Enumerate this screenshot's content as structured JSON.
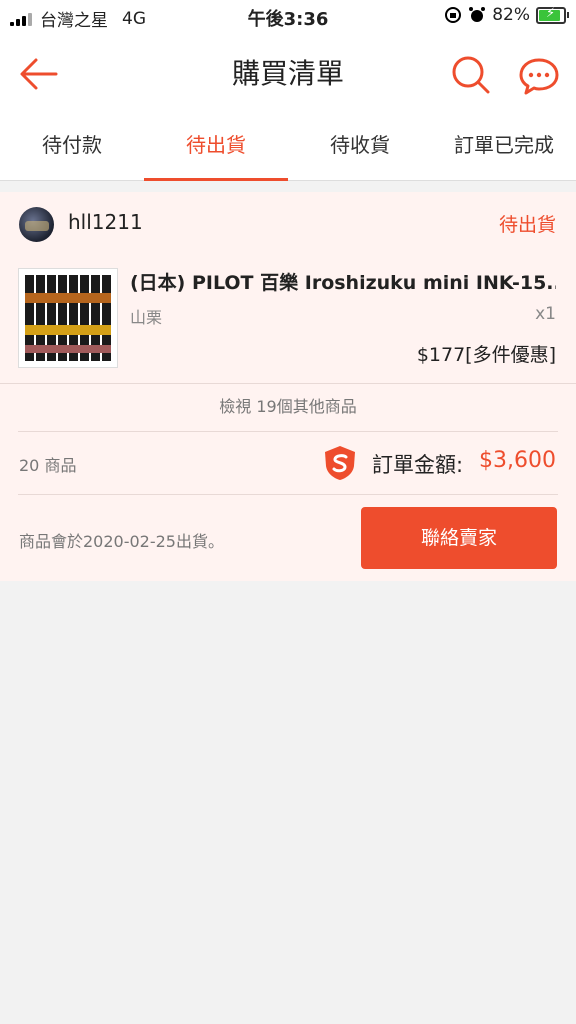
{
  "status_bar": {
    "carrier": "台灣之星",
    "network": "4G",
    "time": "午後3:36",
    "battery_percent": "82%",
    "battery_level": 0.82
  },
  "header": {
    "title": "購買清單"
  },
  "tabs": [
    {
      "label": "待付款",
      "active": false
    },
    {
      "label": "待出貨",
      "active": true
    },
    {
      "label": "待收貨",
      "active": false
    },
    {
      "label": "訂單已完成",
      "active": false
    }
  ],
  "order": {
    "shop_name": "hll1211",
    "status": "待出貨",
    "product": {
      "title": "(日本) PILOT 百樂 Iroshizuku mini INK-15...",
      "variation": "山栗",
      "quantity": "x1",
      "price": "$177",
      "promo": "[多件優惠]"
    },
    "view_more": "檢視 19個其他商品",
    "item_count": "20 商品",
    "total_label": "訂單金額:",
    "total_amount": "$3,600",
    "ship_note": "商品會於2020-02-25出貨。",
    "contact_button": "聯絡賣家"
  },
  "colors": {
    "accent": "#ee4d2d",
    "card_bg": "#fff3f1",
    "page_bg": "#f2f2f2"
  },
  "icons": [
    "back-arrow-icon",
    "search-icon",
    "chat-icon",
    "shield-logo-icon",
    "alarm-icon",
    "lock-rotation-icon"
  ]
}
